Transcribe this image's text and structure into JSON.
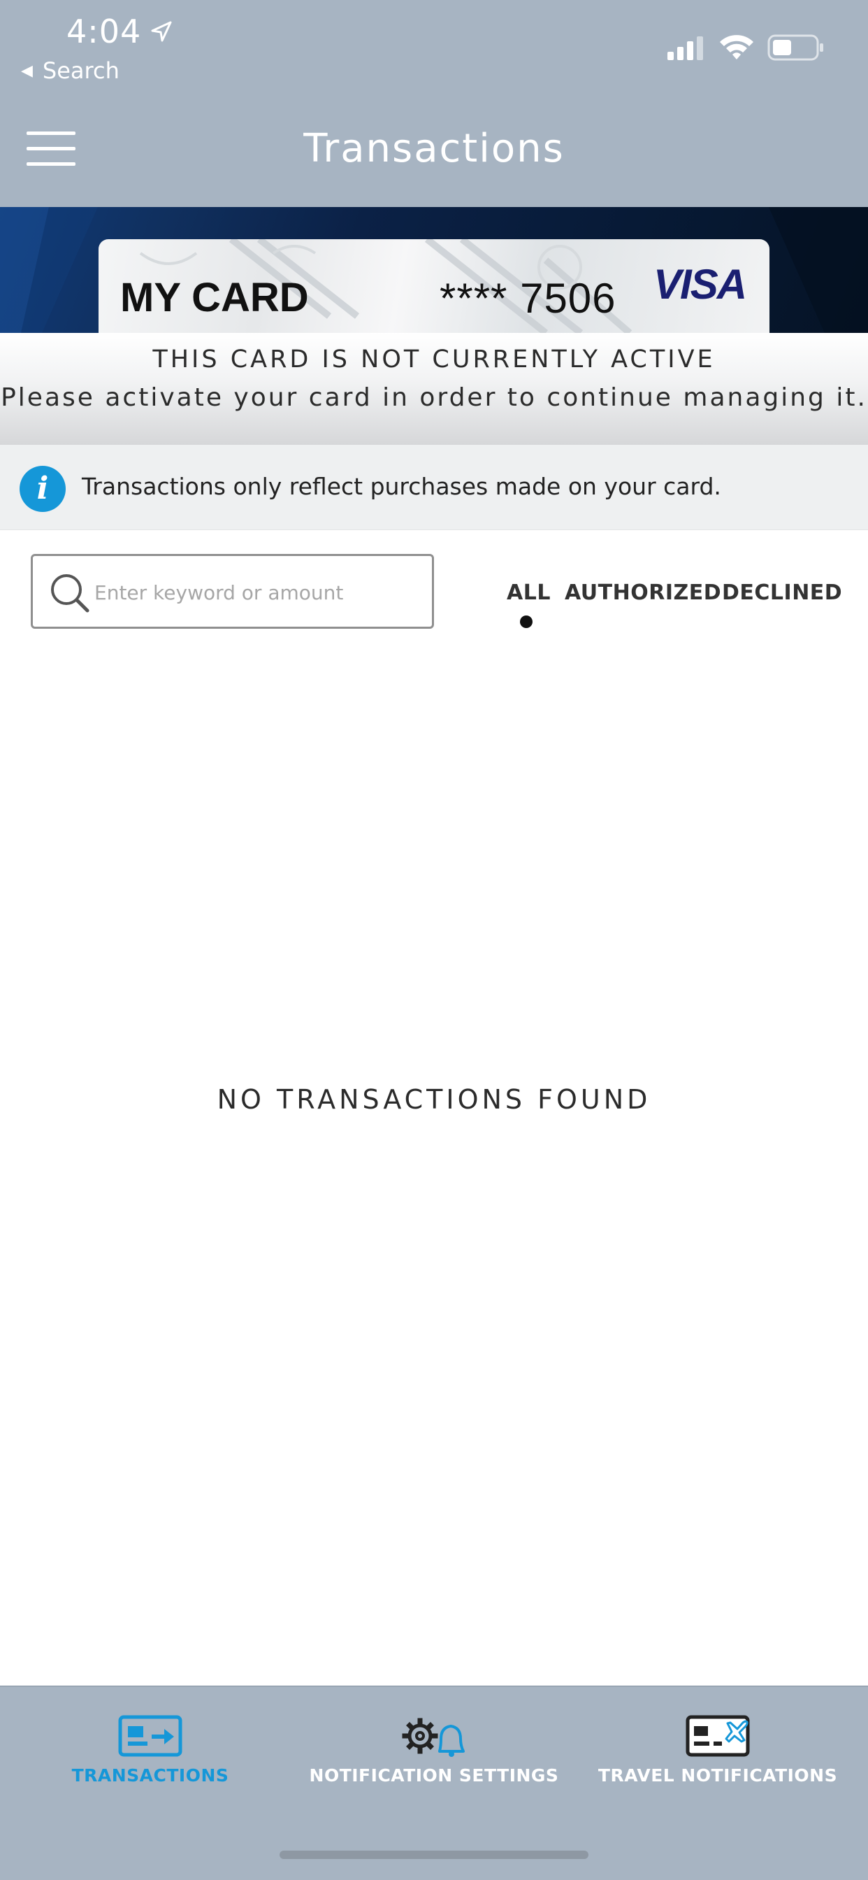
{
  "status_bar": {
    "time": "4:04",
    "back_label": "Search",
    "icons": [
      "location-arrow-icon",
      "signal-icon",
      "wifi-icon",
      "battery-icon"
    ]
  },
  "header": {
    "title": "Transactions",
    "menu_icon": "hamburger-menu-icon"
  },
  "card": {
    "name": "MY CARD",
    "number": "**** 7506",
    "brand": "VISA"
  },
  "inactive_notice": {
    "title": "THIS CARD IS NOT CURRENTLY ACTIVE",
    "message": "Please activate your card in order to continue managing it."
  },
  "info_bar": {
    "icon": "info-icon",
    "text": "Transactions only reflect purchases made on your card."
  },
  "search": {
    "placeholder": "Enter keyword or amount",
    "value": ""
  },
  "filters": {
    "items": [
      {
        "label": "ALL",
        "selected": true
      },
      {
        "label": "AUTHORIZED",
        "selected": false
      },
      {
        "label": "DECLINED",
        "selected": false
      }
    ]
  },
  "empty_state": {
    "text": "NO TRANSACTIONS FOUND"
  },
  "tabbar": {
    "tabs": [
      {
        "label": "TRANSACTIONS",
        "icon": "card-transactions-icon",
        "active": true
      },
      {
        "label": "NOTIFICATION SETTINGS",
        "icon": "gear-bell-icon",
        "active": false
      },
      {
        "label": "TRAVEL NOTIFICATIONS",
        "icon": "card-airplane-icon",
        "active": false
      }
    ]
  },
  "colors": {
    "header_bg": "#a7b4c2",
    "accent": "#1597d8",
    "visa_blue": "#1a1f71"
  }
}
